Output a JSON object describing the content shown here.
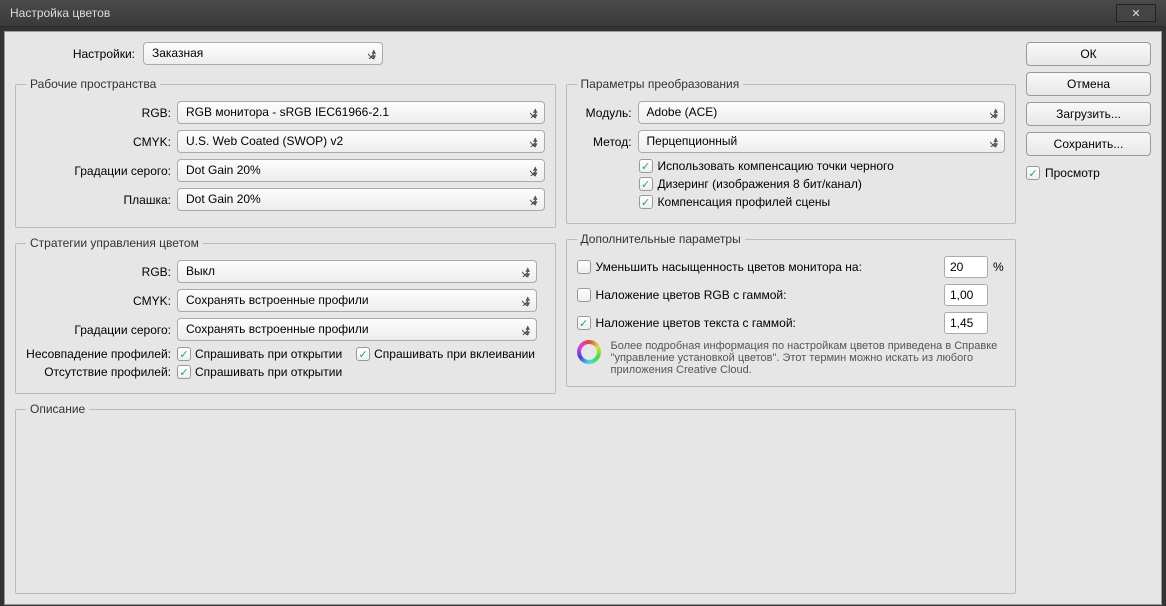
{
  "title": "Настройка цветов",
  "settings_label": "Настройки:",
  "settings_value": "Заказная",
  "workspaces": {
    "legend": "Рабочие пространства",
    "rgb_label": "RGB:",
    "rgb_value": "RGB монитора - sRGB IEC61966-2.1",
    "cmyk_label": "CMYK:",
    "cmyk_value": "U.S. Web Coated (SWOP) v2",
    "gray_label": "Градации серого:",
    "gray_value": "Dot Gain 20%",
    "spot_label": "Плашка:",
    "spot_value": "Dot Gain 20%"
  },
  "policies": {
    "legend": "Стратегии управления цветом",
    "rgb_label": "RGB:",
    "rgb_value": "Выкл",
    "cmyk_label": "CMYK:",
    "cmyk_value": "Сохранять встроенные профили",
    "gray_label": "Градации серого:",
    "gray_value": "Сохранять встроенные профили",
    "mismatch_label": "Несовпадение профилей:",
    "mismatch_open": "Спрашивать при открытии",
    "mismatch_paste": "Спрашивать при вклеивании",
    "missing_label": "Отсутствие профилей:",
    "missing_open": "Спрашивать при открытии"
  },
  "conversion": {
    "legend": "Параметры преобразования",
    "engine_label": "Модуль:",
    "engine_value": "Adobe (ACE)",
    "intent_label": "Метод:",
    "intent_value": "Перцепционный",
    "bpc": "Использовать компенсацию точки черного",
    "dither": "Дизеринг (изображения 8 бит/канал)",
    "scene": "Компенсация профилей сцены"
  },
  "advanced": {
    "legend": "Дополнительные параметры",
    "desat_label": "Уменьшить насыщенность цветов монитора на:",
    "desat_value": "20",
    "desat_unit": "%",
    "rgb_gamma_label": "Наложение цветов RGB с гаммой:",
    "rgb_gamma_value": "1,00",
    "text_gamma_label": "Наложение цветов текста с гаммой:",
    "text_gamma_value": "1,45"
  },
  "info_text": "Более подробная информация по настройкам цветов приведена в Справке \"управление установкой цветов\". Этот термин можно искать из любого приложения Creative Cloud.",
  "description": {
    "legend": "Описание"
  },
  "buttons": {
    "ok": "ОК",
    "cancel": "Отмена",
    "load": "Загрузить...",
    "save": "Сохранить..."
  },
  "preview_label": "Просмотр"
}
